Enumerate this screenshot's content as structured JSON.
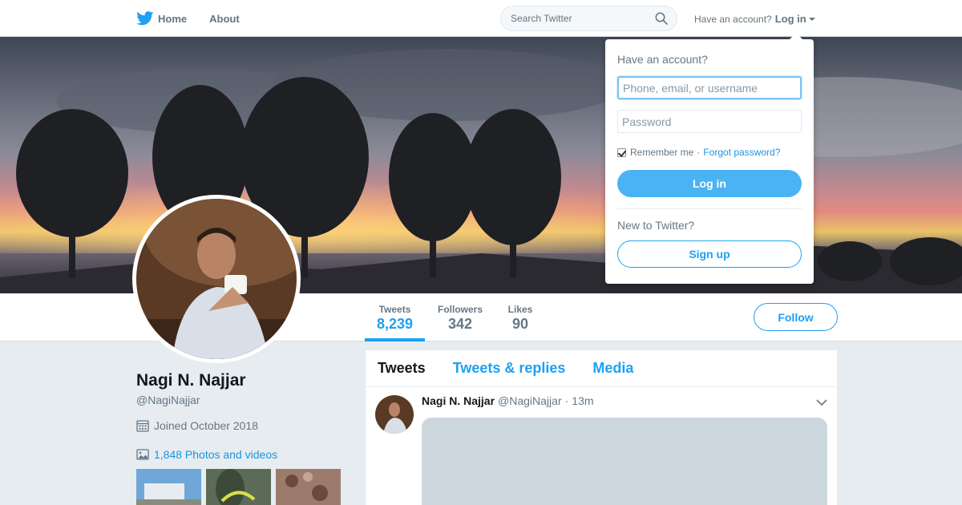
{
  "nav": {
    "home_label": "Home",
    "about_label": "About",
    "search_placeholder": "Search Twitter",
    "account_prompt": "Have an account?",
    "login_label": "Log in"
  },
  "profile": {
    "name": "Nagi N. Najjar",
    "handle": "@NagiNajjar",
    "joined": "Joined October 2018",
    "photos_label": "1,848 Photos and videos",
    "follow_label": "Follow",
    "stats": [
      {
        "label": "Tweets",
        "value": "8,239",
        "active": true
      },
      {
        "label": "Followers",
        "value": "342",
        "active": false
      },
      {
        "label": "Likes",
        "value": "90",
        "active": false
      }
    ]
  },
  "timeline": {
    "tabs": [
      "Tweets",
      "Tweets & replies",
      "Media"
    ],
    "active_tab": "Tweets",
    "tweet": {
      "name": "Nagi N. Najjar",
      "handle": "@NagiNajjar",
      "separator": "·",
      "time": "13m"
    }
  },
  "login_dropdown": {
    "title": "Have an account?",
    "username_placeholder": "Phone, email, or username",
    "password_placeholder": "Password",
    "remember_label": "Remember me",
    "remember_checked": true,
    "separator": "·",
    "forgot_label": "Forgot password?",
    "login_button": "Log in",
    "new_prompt": "New to Twitter?",
    "signup_button": "Sign up"
  },
  "colors": {
    "accent": "#1da1f2",
    "login_button": "#4ab3f4",
    "page_background": "#e6ecf0"
  },
  "icons": [
    "twitter-bird-icon",
    "search-icon",
    "caret-down-icon",
    "calendar-icon",
    "photo-icon",
    "chevron-down-icon",
    "checkbox-checked-icon"
  ]
}
